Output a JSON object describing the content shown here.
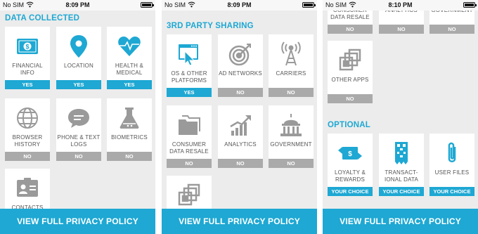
{
  "statusbar": {
    "carrier": "No SIM",
    "times": [
      "8:09 PM",
      "8:09 PM",
      "8:10 PM"
    ]
  },
  "screen1": {
    "title": "DATA COLLECTED",
    "tiles": [
      {
        "label": "FINANCIAL INFO",
        "badge": "YES"
      },
      {
        "label": "LOCATION",
        "badge": "YES"
      },
      {
        "label": "HEALTH & MEDICAL",
        "badge": "YES"
      },
      {
        "label": "BROWSER HISTORY",
        "badge": "NO"
      },
      {
        "label": "PHONE & TEXT LOGS",
        "badge": "NO"
      },
      {
        "label": "BIOMETRICS",
        "badge": "NO"
      },
      {
        "label": "CONTACTS",
        "badge": ""
      }
    ]
  },
  "screen2": {
    "title": "3RD PARTY SHARING",
    "tiles": [
      {
        "label": "OS & OTHER PLATFORMS",
        "badge": "YES"
      },
      {
        "label": "AD NETWORKS",
        "badge": "NO"
      },
      {
        "label": "CARRIERS",
        "badge": "NO"
      },
      {
        "label": "CONSUMER DATA RESALE",
        "badge": "NO"
      },
      {
        "label": "ANALYTICS",
        "badge": "NO"
      },
      {
        "label": "GOVERNMENT",
        "badge": "NO"
      }
    ]
  },
  "screen3": {
    "partial_tiles": [
      {
        "label": "CONSUMER DATA RESALE",
        "badge": "NO"
      },
      {
        "label": "ANALYTICS",
        "badge": "NO"
      },
      {
        "label": "GOVERNMENT",
        "badge": "NO"
      }
    ],
    "other_tile": {
      "label": "OTHER APPS",
      "badge": "NO"
    },
    "optional_title": "OPTIONAL",
    "optional_tiles": [
      {
        "label": "LOYALTY & REWARDS",
        "badge": "YOUR CHOICE"
      },
      {
        "label": "TRANSACT-IONAL DATA",
        "badge": "YOUR CHOICE"
      },
      {
        "label": "USER FILES",
        "badge": "YOUR CHOICE"
      }
    ]
  },
  "footer": {
    "label": "VIEW FULL PRIVACY POLICY"
  },
  "colors": {
    "accent": "#1ea8d3",
    "no_badge": "#aaaaaa",
    "icon_gray": "#9a9a9a",
    "background": "#ececec"
  },
  "icons": [
    "dollar-bill-icon",
    "map-pin-icon",
    "heart-pulse-icon",
    "globe-icon",
    "chat-bubble-icon",
    "flask-icon",
    "id-card-icon",
    "window-cursor-icon",
    "target-icon",
    "radio-tower-icon",
    "folders-icon",
    "trend-chart-icon",
    "capitol-icon",
    "stacked-squares-icon",
    "exchange-card-icon",
    "qr-receipt-icon",
    "paperclip-icon"
  ]
}
